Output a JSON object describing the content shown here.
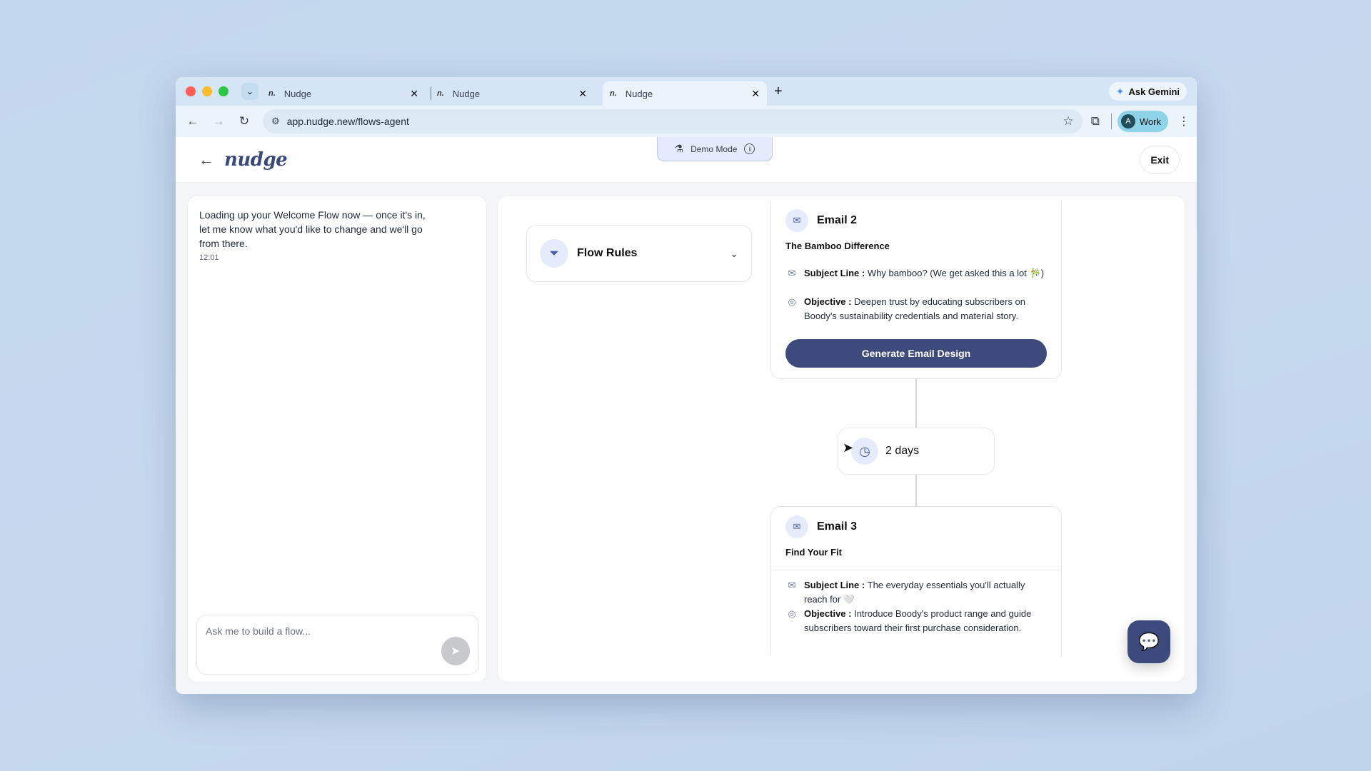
{
  "browser": {
    "tabs": [
      {
        "favicon": "n.",
        "label": "Nudge"
      },
      {
        "favicon": "n.",
        "label": "Nudge"
      },
      {
        "favicon": "n.",
        "label": "Nudge"
      }
    ],
    "ask_gemini": "Ask Gemini",
    "url": "app.nudge.new/flows-agent",
    "profile_initial": "A",
    "profile_label": "Work"
  },
  "header": {
    "logo": "nudge",
    "demo_mode": "Demo Mode",
    "exit": "Exit"
  },
  "chat": {
    "message": "Loading up your Welcome Flow now — once it's in, let me know what you'd like to change and we'll go from there.",
    "time": "12:01",
    "input_placeholder": "Ask me to build a flow..."
  },
  "flow_rules": {
    "label": "Flow Rules"
  },
  "emails": [
    {
      "title": "Email 2",
      "subtitle": "The Bamboo Difference",
      "subject_label": "Subject Line :",
      "subject": "Why bamboo? (We get asked this a lot 🎋)",
      "objective_label": "Objective :",
      "objective": "Deepen trust by educating subscribers on Boody's sustainability credentials and material story.",
      "button": "Generate Email Design"
    },
    {
      "title": "Email 3",
      "subtitle": "Find Your Fit",
      "subject_label": "Subject Line :",
      "subject": "The everyday essentials you'll actually reach for 🤍",
      "objective_label": "Objective :",
      "objective": "Introduce Boody's product range and guide subscribers toward their first purchase consideration."
    }
  ],
  "delay": {
    "label": "2 days"
  },
  "colors": {
    "primary": "#3c4a7c",
    "accent_bg": "#e6ecfb"
  }
}
